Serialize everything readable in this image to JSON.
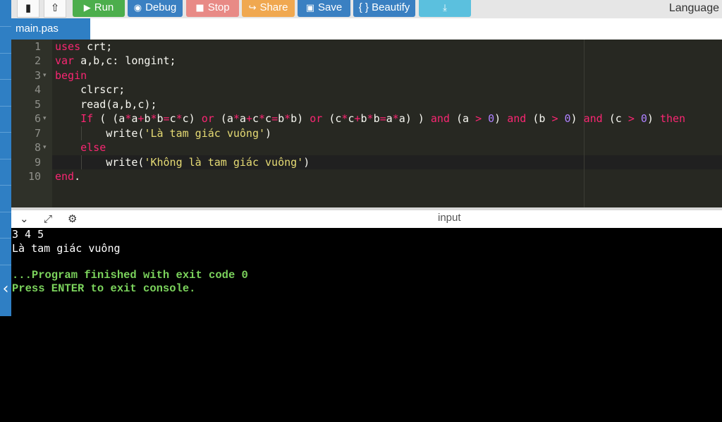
{
  "toolbar": {
    "buttons": [
      {
        "label": "Run",
        "icon": "play-icon",
        "color": "#4cae4c"
      },
      {
        "label": "Debug",
        "icon": "debug-icon",
        "color": "#3a80c2"
      },
      {
        "label": "Stop",
        "icon": "stop-icon",
        "color": "#e88a86"
      },
      {
        "label": "Share",
        "icon": "share-icon",
        "color": "#f0a850"
      },
      {
        "label": "Save",
        "icon": "save-icon",
        "color": "#3a80c2"
      },
      {
        "label": "{ } Beautify",
        "icon": "",
        "color": "#3a80c2"
      },
      {
        "label": "",
        "icon": "download-icon",
        "color": "#5bc0de"
      }
    ],
    "language_label": "Language"
  },
  "tabs": [
    {
      "label": "main.pas"
    }
  ],
  "editor": {
    "line_numbers": [
      "1",
      "2",
      "3",
      "4",
      "5",
      "6",
      "7",
      "8",
      "9",
      "10"
    ],
    "folds": [
      3,
      6,
      8
    ]
  },
  "io": {
    "input_label": "input",
    "console_lines": [
      {
        "text": "3 4 5",
        "style": "white"
      },
      {
        "text": "Là tam giác vuông",
        "style": "white"
      },
      {
        "text": "",
        "style": "white"
      },
      {
        "text": "...Program finished with exit code 0",
        "style": "green"
      },
      {
        "text": "Press ENTER to exit console.",
        "style": "green"
      }
    ]
  },
  "colors": {
    "editor_bg": "#272822",
    "keyword": "#f92672",
    "string": "#e6db74",
    "number": "#ae81ff",
    "accent_blue": "#2f7fc4"
  }
}
